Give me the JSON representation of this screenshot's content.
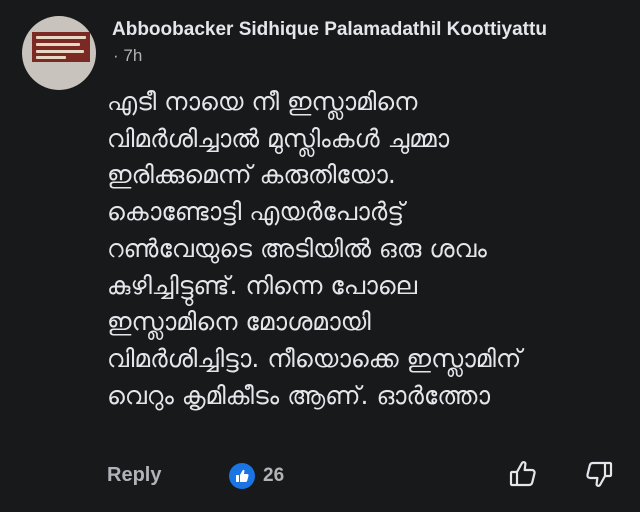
{
  "comment": {
    "author": "Abboobacker Sidhique Palamadathil Koottiyattu",
    "timestamp": "· 7h",
    "avatar_icon": "profile-photo-banner",
    "text_lines": [
      "എടീ നായെ നീ ഇസ്ലാമിനെ",
      "വിമർശിച്ചാൽ മുസ്ലിംകൾ ചുമ്മാ",
      "ഇരിക്കുമെന്ന് കരുതിയോ.",
      "കൊണ്ടോട്ടി എയർപോർട്ട്",
      "റൺവേയുടെ അടിയിൽ ഒരു ശവം",
      "കുഴിച്ചിട്ടുണ്ട്. നിന്നെ പോലെ",
      "ഇസ്ലാമിനെ മോശമായി",
      "വിമർശിച്ചിട്ടാ. നീയൊക്കെ ഇസ്ലാമിന്",
      "വെറും കൃമികീടം ആണ്. ഓർത്തോ"
    ]
  },
  "actions": {
    "reply_label": "Reply",
    "like_count": "26",
    "like_icon": "thumbs-up-reaction",
    "upvote_icon": "thumbs-up-outline",
    "downvote_icon": "thumbs-down-outline"
  },
  "colors": {
    "background": "#18191a",
    "primary_text": "#e4e6eb",
    "secondary_text": "#b0b3b8",
    "like_blue": "#1b74e4"
  }
}
